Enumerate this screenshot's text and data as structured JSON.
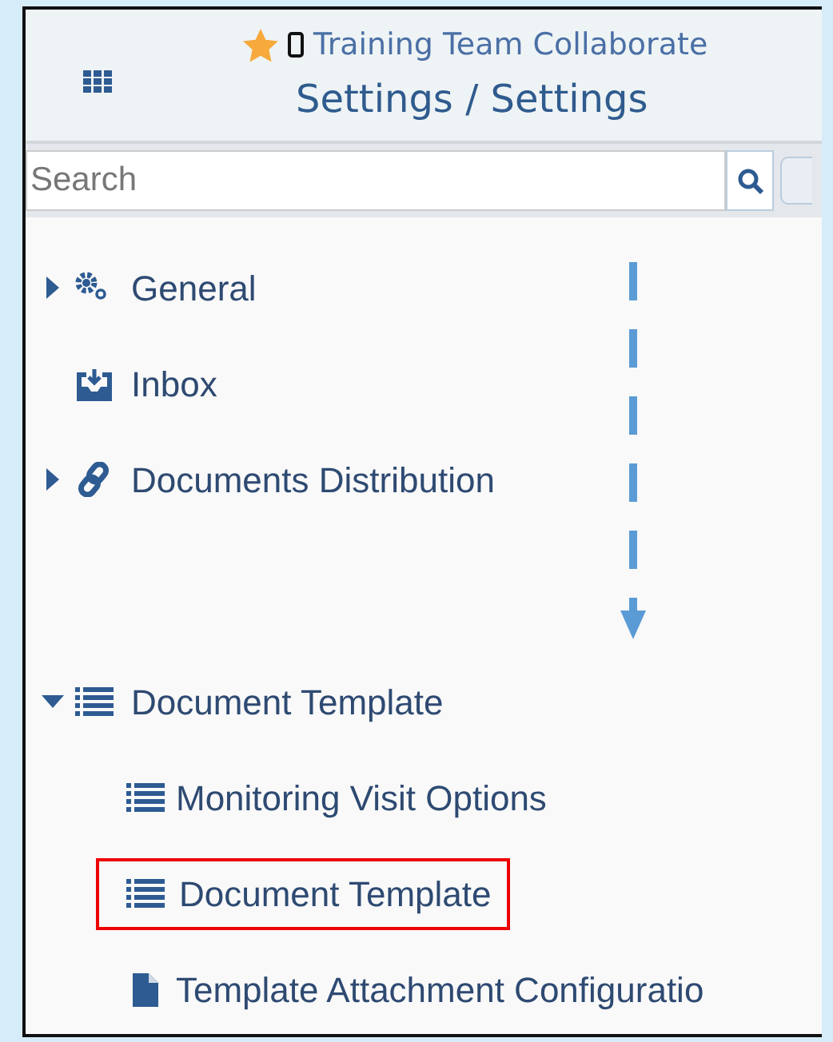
{
  "header": {
    "favorite": true,
    "device_icon": true,
    "title": "Training Team Collaborate",
    "subtitle": "Settings / Settings"
  },
  "search": {
    "placeholder": "Search"
  },
  "tree": [
    {
      "label": "General",
      "kind": "gears",
      "expanded": false,
      "highlighted": false
    },
    {
      "label": "Inbox",
      "kind": "inbox",
      "highlighted": false
    },
    {
      "label": "Documents Distribution",
      "kind": "link",
      "expanded": false,
      "highlighted": false
    },
    {
      "label": "Document Template",
      "kind": "list",
      "expanded": true,
      "highlighted": false,
      "children": [
        {
          "label": "Monitoring Visit Options",
          "kind": "list",
          "highlighted": false
        },
        {
          "label": "Document Template",
          "kind": "list",
          "highlighted": true
        },
        {
          "label": "Template Attachment Configuratio",
          "kind": "file",
          "highlighted": false
        }
      ]
    }
  ],
  "annotation": {
    "kind": "dashed-arrow"
  }
}
